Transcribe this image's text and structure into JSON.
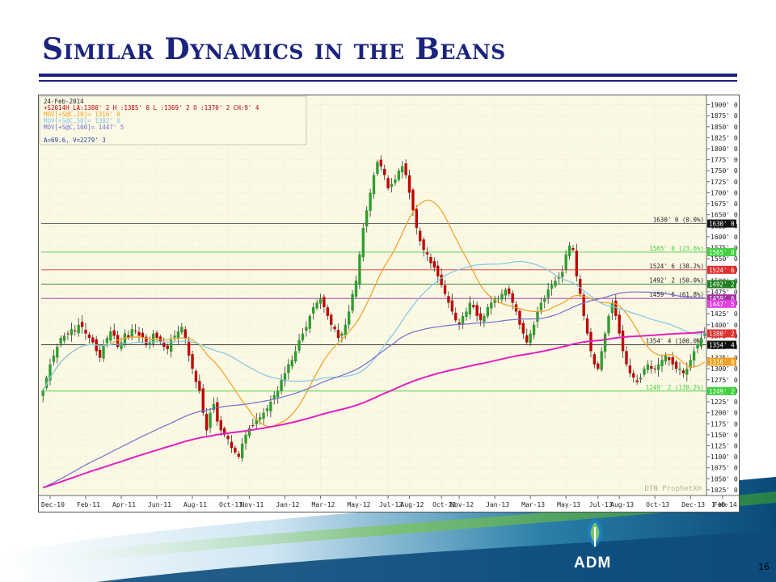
{
  "slide": {
    "title": "Similar Dynamics in the Beans",
    "page_number": "16",
    "logo_text": "ADM"
  },
  "header_lines": [
    "24-Feb-2014",
    "+S2014H LA:1380' 2 H :1385' 0 L :1369' 2 O :1370' 2 CH:9' 4",
    "MOV[+S@C,20]= 1316' 0",
    "MOV[+S@C,50]= 1382' 0",
    "MOV[+S@C,100]= 1447' 5",
    "",
    "A=69.6, V=2279' 3"
  ],
  "watermark": "DTN ProphetX®",
  "colors": {
    "up_candle": "#2e9e2e",
    "down_candle": "#c00000",
    "ma20": "#f0a020",
    "ma50": "#7ec8e8",
    "ma100": "#7070d0",
    "ma200": "#e020c0",
    "title": "#1a237e"
  },
  "chart_data": {
    "type": "line",
    "title": "",
    "y_ticks": [
      "1900' 0",
      "1875' 0",
      "1850' 0",
      "1825' 0",
      "1800' 0",
      "1775' 0",
      "1750' 0",
      "1725' 0",
      "1700' 0",
      "1675' 0",
      "1650' 0",
      "1625' 0",
      "1600' 0",
      "1575' 0",
      "1550' 0",
      "1525' 0",
      "1500' 0",
      "1475' 0",
      "1450' 0",
      "1425' 0",
      "1400' 0",
      "1375' 0",
      "1350' 0",
      "1325' 0",
      "1300' 0",
      "1275' 0",
      "1250' 0",
      "1225' 0",
      "1200' 0",
      "1175' 0",
      "1150' 0",
      "1125' 0",
      "1100' 0",
      "1075' 0",
      "1050' 0",
      "1025' 0"
    ],
    "ylim": [
      1012,
      1912
    ],
    "x_ticks": [
      "Dec-10",
      "Feb-11",
      "Apr-11",
      "Jun-11",
      "Aug-11",
      "Oct-11",
      "Nov-11",
      "Jan-12",
      "Mar-12",
      "May-12",
      "Jul-12",
      "Aug-12",
      "Oct-12",
      "Nov-12",
      "Jan-13",
      "Mar-13",
      "May-13",
      "Jul-13",
      "Aug-13",
      "Oct-13",
      "Dec-13",
      "Feb-14"
    ],
    "x_tick_idx": [
      2,
      12,
      22,
      32,
      42,
      52,
      58,
      68,
      78,
      88,
      97,
      103,
      112,
      117,
      127,
      137,
      147,
      156,
      162,
      172,
      182,
      191
    ],
    "frequency_label": "1 Wk",
    "close": [
      1250,
      1280,
      1310,
      1330,
      1350,
      1370,
      1375,
      1380,
      1390,
      1385,
      1400,
      1395,
      1380,
      1370,
      1360,
      1340,
      1325,
      1355,
      1370,
      1385,
      1375,
      1350,
      1360,
      1380,
      1370,
      1390,
      1385,
      1375,
      1370,
      1355,
      1360,
      1380,
      1370,
      1360,
      1350,
      1345,
      1365,
      1375,
      1385,
      1395,
      1370,
      1330,
      1300,
      1270,
      1250,
      1200,
      1160,
      1200,
      1220,
      1180,
      1160,
      1150,
      1140,
      1120,
      1110,
      1100,
      1130,
      1150,
      1165,
      1170,
      1185,
      1190,
      1200,
      1210,
      1225,
      1240,
      1250,
      1275,
      1290,
      1310,
      1320,
      1340,
      1365,
      1380,
      1395,
      1420,
      1440,
      1450,
      1460,
      1440,
      1420,
      1400,
      1390,
      1370,
      1380,
      1400,
      1430,
      1470,
      1500,
      1560,
      1620,
      1660,
      1700,
      1740,
      1770,
      1760,
      1740,
      1710,
      1720,
      1730,
      1750,
      1760,
      1740,
      1700,
      1660,
      1620,
      1590,
      1570,
      1560,
      1540,
      1530,
      1510,
      1490,
      1470,
      1450,
      1430,
      1410,
      1400,
      1420,
      1430,
      1450,
      1440,
      1420,
      1410,
      1420,
      1440,
      1450,
      1460,
      1460,
      1470,
      1480,
      1470,
      1450,
      1430,
      1400,
      1380,
      1360,
      1380,
      1400,
      1430,
      1450,
      1460,
      1480,
      1490,
      1500,
      1510,
      1520,
      1560,
      1580,
      1570,
      1510,
      1470,
      1420,
      1380,
      1340,
      1310,
      1300,
      1340,
      1380,
      1420,
      1450,
      1420,
      1380,
      1340,
      1310,
      1290,
      1280,
      1270,
      1280,
      1300,
      1310,
      1300,
      1300,
      1310,
      1320,
      1330,
      1320,
      1310,
      1300,
      1300,
      1290,
      1300,
      1320,
      1340,
      1355,
      1370,
      1380
    ],
    "series": [
      {
        "name": "MOV[+S@C,20]",
        "value": "1316' 0",
        "color": "#f0a020",
        "period": 20
      },
      {
        "name": "MOV[+S@C,50]",
        "value": "1382' 0",
        "color": "#7ec8e8",
        "period": 50
      },
      {
        "name": "MOV[+S@C,100]",
        "value": "1447' 5",
        "color": "#7070d0",
        "period": 100
      },
      {
        "name": "",
        "value": "",
        "color": "#e020c0",
        "period": 200
      }
    ],
    "levels": [
      {
        "price": 1630.0,
        "label": "1630' 0 (0.0%)",
        "tag": "1630' 0",
        "line": "#555555",
        "tag_bg": "#111111",
        "tag_fg": "#ffffff"
      },
      {
        "price": 1565.0,
        "label": "1565' 0 (23.6%)",
        "tag": "1565' 0",
        "line": "#40d040",
        "tag_bg": "#40d040",
        "tag_fg": "#ffffff",
        "label_color": "#40d040"
      },
      {
        "price": 1524.75,
        "label": "1524' 6 (38.2%)",
        "tag": "1524' 6",
        "line": "#e03030",
        "tag_bg": "#e03030",
        "tag_fg": "#ffffff"
      },
      {
        "price": 1492.25,
        "label": "1492' 2 (50.0%)",
        "tag": "1492' 2",
        "line": "#208020",
        "tag_bg": "#208020",
        "tag_fg": "#ffffff"
      },
      {
        "price": 1459.75,
        "label": "1459' 6 (61.8%)",
        "tag": "1459' 6",
        "line": "#a030a0",
        "tag_bg": "#a030a0",
        "tag_fg": "#ffffff"
      },
      {
        "price": 1354.5,
        "label": "1354' 4 (100.0%)",
        "tag": "1354' 4",
        "line": "#222222",
        "tag_bg": "#111111",
        "tag_fg": "#ffffff"
      },
      {
        "price": 1249.25,
        "label": "1249' 2 (138.2%)",
        "tag": "1249' 2",
        "line": "#40d040",
        "tag_bg": "#40d040",
        "tag_fg": "#ffffff",
        "label_color": "#40d040"
      }
    ],
    "price_tags": [
      {
        "price": 1447.6,
        "tag": "1447' 5",
        "bg": "#e040e0",
        "fg": "#ffffff"
      },
      {
        "price": 1380.25,
        "tag": "1380' 2",
        "bg": "#e03030",
        "fg": "#ffffff"
      },
      {
        "price": 1316.0,
        "tag": "1316' 0",
        "bg": "#f0a020",
        "fg": "#ffffff"
      }
    ]
  }
}
